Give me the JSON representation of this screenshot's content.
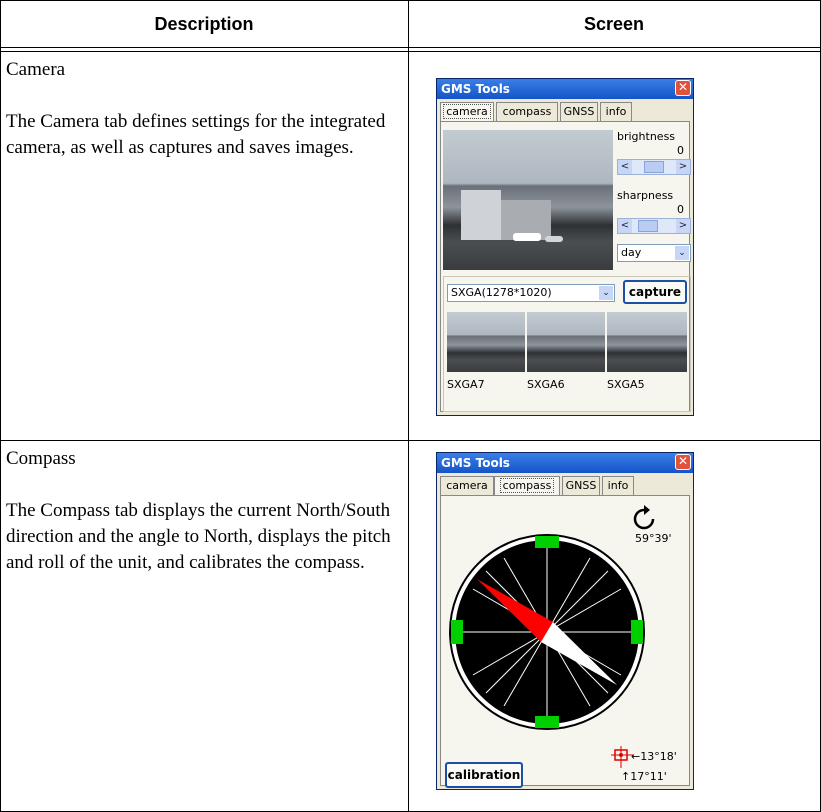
{
  "table": {
    "headers": [
      "Description",
      "Screen"
    ],
    "rows": [
      {
        "title": "Camera",
        "body": "The Camera tab defines settings for the integrated camera, as well as captures and saves images."
      },
      {
        "title": "Compass",
        "body": "The Compass tab displays the current North/South direction and the angle to North, displays the pitch and roll of the unit, and calibrates the compass."
      }
    ]
  },
  "camera_window": {
    "title": "GMS Tools",
    "close_glyph": "✕",
    "tabs": [
      "camera",
      "compass",
      "GNSS",
      "info"
    ],
    "active_tab": "camera",
    "brightness_label": "brightness",
    "brightness_value": "0",
    "sharpness_label": "sharpness",
    "sharpness_value": "0",
    "mode_value": "day",
    "resolution_value": "SXGA(1278*1020)",
    "capture_label": "capture",
    "thumbnails": [
      "SXGA7",
      "SXGA6",
      "SXGA5"
    ],
    "arrow_left": "<",
    "arrow_right": ">",
    "dropdown_glyph": "⌄"
  },
  "compass_window": {
    "title": "GMS Tools",
    "close_glyph": "✕",
    "tabs": [
      "camera",
      "compass",
      "GNSS",
      "info"
    ],
    "active_tab": "compass",
    "heading_angle": "59°39'",
    "pitch_angle": "13°18'",
    "roll_angle": "17°11'",
    "calibration_label": "calibration",
    "roll_arrow": "↑",
    "pitch_arrow": "←",
    "colors": {
      "needle_north": "#ff0000",
      "needle_south": "#ffffff",
      "markers": "#00d000",
      "dial": "#000000"
    }
  }
}
